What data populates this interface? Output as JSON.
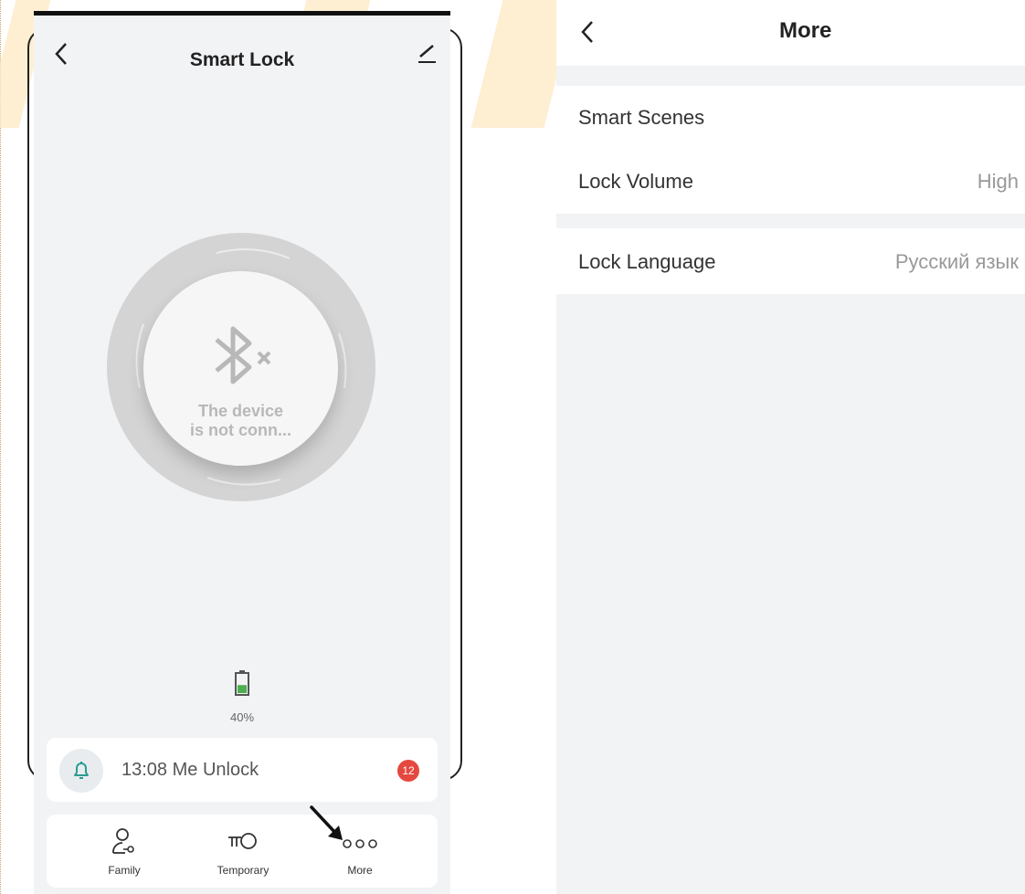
{
  "left_screen": {
    "title": "Smart Lock",
    "status_line1": "The device",
    "status_line2": "is not conn...",
    "battery_text": "40%",
    "battery_level": 0.4,
    "notification": {
      "text": "13:08 Me Unlock",
      "badge": "12"
    },
    "toolbar": [
      {
        "label": "Family",
        "icon": "family-key-icon"
      },
      {
        "label": "Temporary",
        "icon": "temporary-key-icon"
      },
      {
        "label": "More",
        "icon": "more-dots-icon"
      }
    ],
    "colors": {
      "badge": "#e5483f",
      "bell": "#2a9d8f",
      "battery": "#4caf50"
    }
  },
  "right_screen": {
    "title": "More",
    "rows": [
      {
        "label": "Smart Scenes",
        "value": ""
      },
      {
        "label": "Lock Volume",
        "value": "High"
      },
      {
        "label": "Lock Language",
        "value": "Русский язык"
      }
    ]
  }
}
